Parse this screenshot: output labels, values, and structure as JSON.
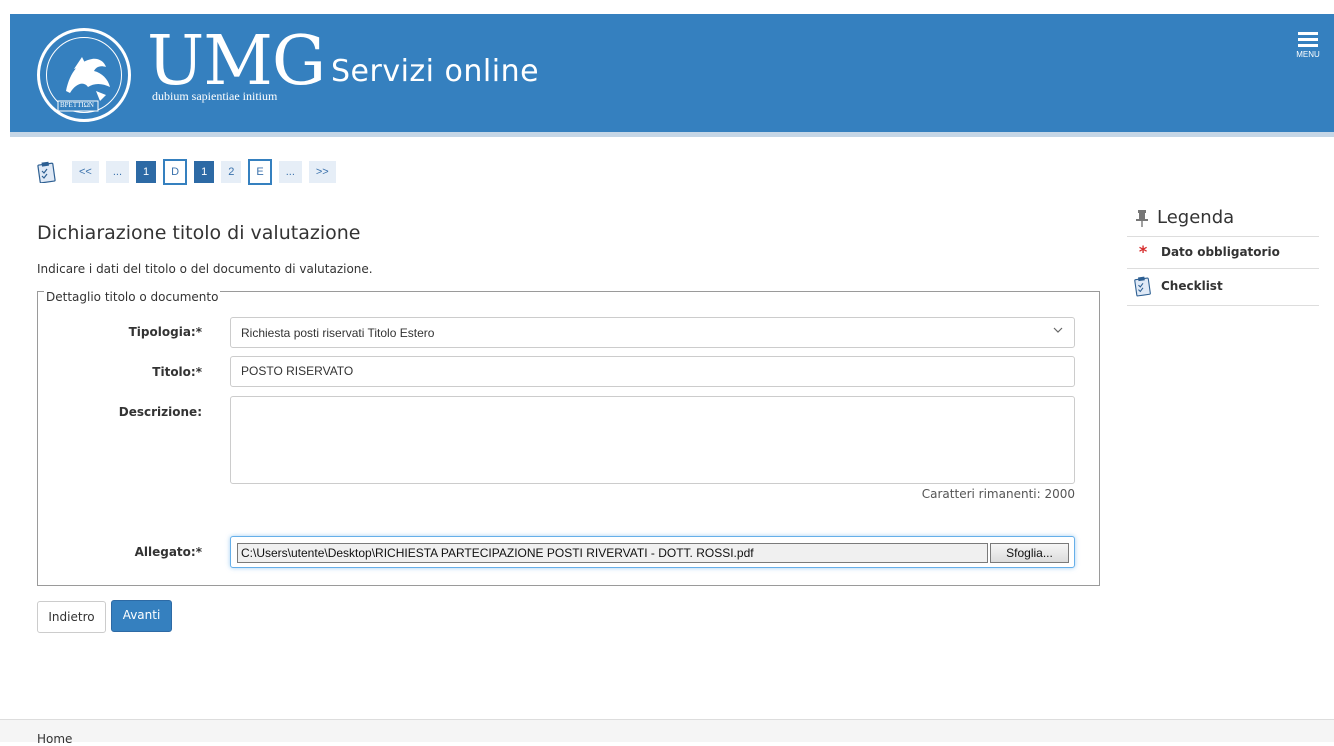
{
  "header": {
    "brand": "UMG",
    "brand_tagline": "dubium sapientiae initium",
    "seal_text": "BPETTIΩN",
    "app_title": "Servizi online",
    "menu_label": "MENU",
    "background_color": "#3580bf"
  },
  "steps": {
    "icon": "checklist-icon",
    "items": [
      "<<",
      "...",
      "1",
      "D",
      "1",
      "2",
      "E",
      "...",
      ">>"
    ]
  },
  "main": {
    "title": "Dichiarazione titolo di valutazione",
    "intro": "Indicare i dati del titolo o del documento di valutazione.",
    "fieldset_legend": "Dettaglio titolo o documento",
    "tipologia_label": "Tipologia:*",
    "tipologia_value": "Richiesta posti riservati Titolo Estero",
    "titolo_label": "Titolo:*",
    "titolo_value": "POSTO RISERVATO",
    "descrizione_label": "Descrizione:",
    "descrizione_value": "",
    "counter": "Caratteri rimanenti: 2000",
    "allegato_label": "Allegato:*",
    "allegato_value": "C:\\Users\\utente\\Desktop\\RICHIESTA PARTECIPAZIONE POSTI RIVERVATI - DOTT. ROSSI.pdf",
    "browse_label": "Sfoglia..."
  },
  "buttons": {
    "back": "Indietro",
    "next": "Avanti"
  },
  "legend": {
    "title": "Legenda",
    "required": "Dato obbligatorio",
    "checklist": "Checklist"
  },
  "footer": {
    "home": "Home"
  }
}
